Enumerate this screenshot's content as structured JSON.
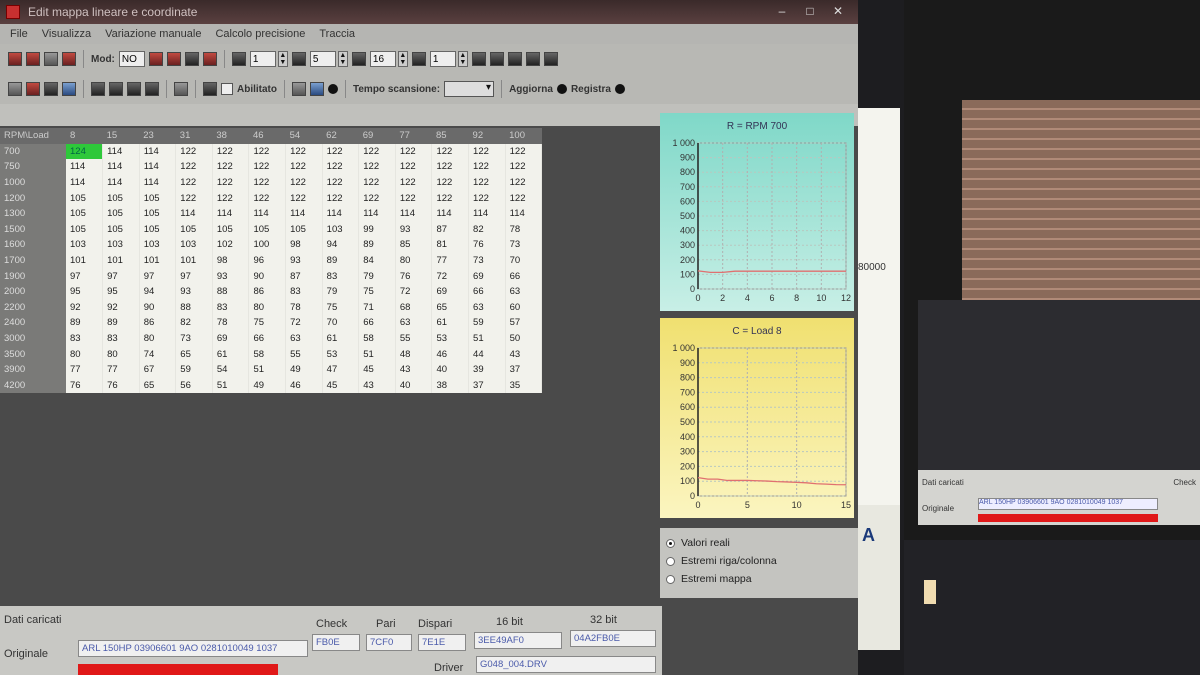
{
  "window": {
    "title": "Edit mappa lineare e coordinate",
    "buttons": [
      "–",
      "□",
      "✕"
    ]
  },
  "menu": [
    "File",
    "Visualizza",
    "Variazione manuale",
    "Calcolo precisione",
    "Traccia"
  ],
  "toolbar1": {
    "mod_label": "Mod:",
    "mod_value": "NO",
    "spin1": "1",
    "spin2": "5",
    "spin3": "16",
    "spin4": "1"
  },
  "toolbar2": {
    "abilitato_label": "Abilitato",
    "tempo_label": "Tempo scansione:",
    "aggiorna_label": "Aggiorna",
    "registra_label": "Registra"
  },
  "grid": {
    "corner": "RPM\\Load",
    "columns": [
      "8",
      "15",
      "23",
      "31",
      "38",
      "46",
      "54",
      "62",
      "69",
      "77",
      "85",
      "92",
      "100"
    ],
    "rows": [
      {
        "label": "700",
        "values": [
          "124",
          "114",
          "114",
          "122",
          "122",
          "122",
          "122",
          "122",
          "122",
          "122",
          "122",
          "122",
          "122"
        ]
      },
      {
        "label": "750",
        "values": [
          "114",
          "114",
          "114",
          "122",
          "122",
          "122",
          "122",
          "122",
          "122",
          "122",
          "122",
          "122",
          "122"
        ]
      },
      {
        "label": "1000",
        "values": [
          "114",
          "114",
          "114",
          "122",
          "122",
          "122",
          "122",
          "122",
          "122",
          "122",
          "122",
          "122",
          "122"
        ]
      },
      {
        "label": "1200",
        "values": [
          "105",
          "105",
          "105",
          "122",
          "122",
          "122",
          "122",
          "122",
          "122",
          "122",
          "122",
          "122",
          "122"
        ]
      },
      {
        "label": "1300",
        "values": [
          "105",
          "105",
          "105",
          "114",
          "114",
          "114",
          "114",
          "114",
          "114",
          "114",
          "114",
          "114",
          "114"
        ]
      },
      {
        "label": "1500",
        "values": [
          "105",
          "105",
          "105",
          "105",
          "105",
          "105",
          "105",
          "103",
          "99",
          "93",
          "87",
          "82",
          "78"
        ]
      },
      {
        "label": "1600",
        "values": [
          "103",
          "103",
          "103",
          "103",
          "102",
          "100",
          "98",
          "94",
          "89",
          "85",
          "81",
          "76",
          "73"
        ]
      },
      {
        "label": "1700",
        "values": [
          "101",
          "101",
          "101",
          "101",
          "98",
          "96",
          "93",
          "89",
          "84",
          "80",
          "77",
          "73",
          "70"
        ]
      },
      {
        "label": "1900",
        "values": [
          "97",
          "97",
          "97",
          "97",
          "93",
          "90",
          "87",
          "83",
          "79",
          "76",
          "72",
          "69",
          "66"
        ]
      },
      {
        "label": "2000",
        "values": [
          "95",
          "95",
          "94",
          "93",
          "88",
          "86",
          "83",
          "79",
          "75",
          "72",
          "69",
          "66",
          "63"
        ]
      },
      {
        "label": "2200",
        "values": [
          "92",
          "92",
          "90",
          "88",
          "83",
          "80",
          "78",
          "75",
          "71",
          "68",
          "65",
          "63",
          "60"
        ]
      },
      {
        "label": "2400",
        "values": [
          "89",
          "89",
          "86",
          "82",
          "78",
          "75",
          "72",
          "70",
          "66",
          "63",
          "61",
          "59",
          "57"
        ]
      },
      {
        "label": "3000",
        "values": [
          "83",
          "83",
          "80",
          "73",
          "69",
          "66",
          "63",
          "61",
          "58",
          "55",
          "53",
          "51",
          "50"
        ]
      },
      {
        "label": "3500",
        "values": [
          "80",
          "80",
          "74",
          "65",
          "61",
          "58",
          "55",
          "53",
          "51",
          "48",
          "46",
          "44",
          "43"
        ]
      },
      {
        "label": "3900",
        "values": [
          "77",
          "77",
          "67",
          "59",
          "54",
          "51",
          "49",
          "47",
          "45",
          "43",
          "40",
          "39",
          "37"
        ]
      },
      {
        "label": "4200",
        "values": [
          "76",
          "76",
          "65",
          "56",
          "51",
          "49",
          "46",
          "45",
          "43",
          "40",
          "38",
          "37",
          "35"
        ]
      }
    ]
  },
  "charts": [
    {
      "title": "R = RPM 700",
      "yticks": [
        "1 000",
        "900",
        "800",
        "700",
        "600",
        "500",
        "400",
        "300",
        "200",
        "100",
        "0"
      ],
      "xticks": [
        "0",
        "2",
        "4",
        "6",
        "8",
        "10",
        "12"
      ],
      "line_color": "#e07070"
    },
    {
      "title": "C = Load 8",
      "yticks": [
        "1 000",
        "900",
        "800",
        "700",
        "600",
        "500",
        "400",
        "300",
        "200",
        "100",
        "0"
      ],
      "xticks": [
        "0",
        "5",
        "10",
        "15"
      ],
      "line_color": "#e07070"
    }
  ],
  "chart_data": [
    {
      "type": "line",
      "title": "R = RPM 700",
      "x": [
        0,
        1,
        2,
        3,
        4,
        5,
        6,
        7,
        8,
        9,
        10,
        11,
        12
      ],
      "series": [
        {
          "values": [
            124,
            114,
            114,
            122,
            122,
            122,
            122,
            122,
            122,
            122,
            122,
            122,
            122
          ]
        }
      ],
      "xlim": [
        0,
        12
      ],
      "ylim": [
        0,
        1000
      ],
      "grid": true
    },
    {
      "type": "line",
      "title": "C = Load 8",
      "x": [
        0,
        1,
        2,
        3,
        4,
        5,
        6,
        7,
        8,
        9,
        10,
        11,
        12,
        13,
        14,
        15
      ],
      "series": [
        {
          "values": [
            124,
            114,
            114,
            105,
            105,
            105,
            103,
            101,
            97,
            95,
            92,
            89,
            83,
            80,
            77,
            76
          ]
        }
      ],
      "xlim": [
        0,
        15
      ],
      "ylim": [
        0,
        1000
      ],
      "grid": true
    }
  ],
  "view_options": {
    "selected": "Valori reali",
    "options": [
      "Valori reali",
      "Estremi riga/colonna",
      "Estremi mappa"
    ]
  },
  "info_panel": {
    "section_title": "Dati caricati",
    "originale_label": "Originale",
    "originale_value": "ARL 150HP 03906601 9AO 0281010049 1037",
    "check_label": "Check",
    "check_value": "FB0E",
    "pari_label": "Pari",
    "pari_value": "7CF0",
    "dispari_label": "Dispari",
    "dispari_value": "7E1E",
    "bit16_label": "16 bit",
    "bit16_value": "3EE49AF0",
    "bit32_label": "32 bit",
    "bit32_value": "04A2FB0E",
    "driver_label": "Driver",
    "driver_value": "G048_004.DRV"
  },
  "background": {
    "partial_number": "80000",
    "logo_fragment": "A"
  }
}
